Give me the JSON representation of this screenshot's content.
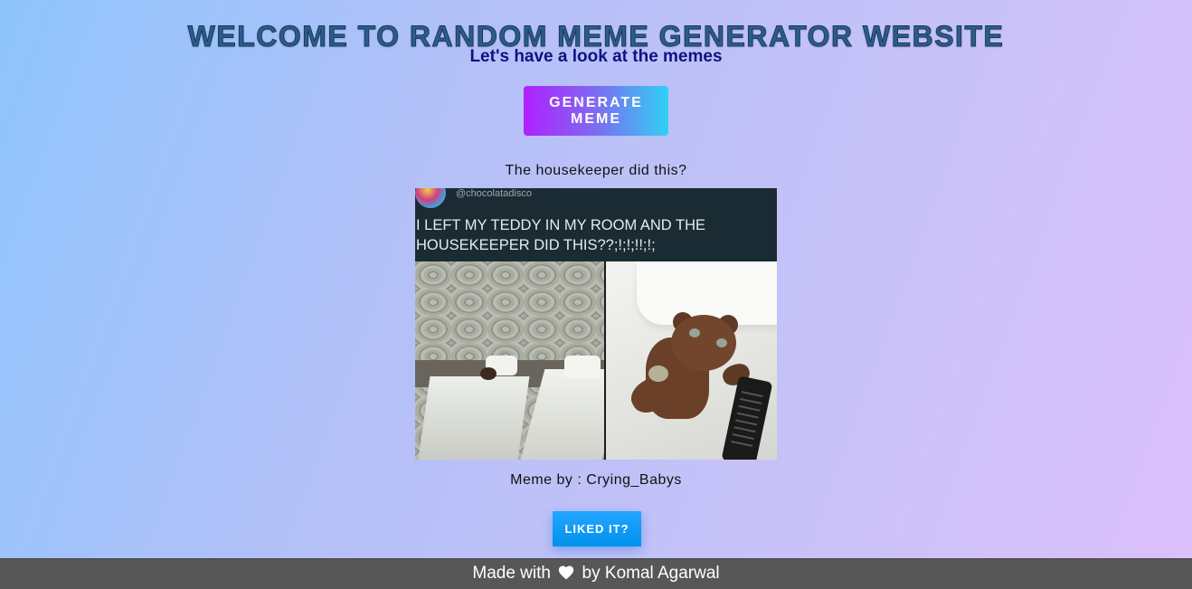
{
  "header": {
    "title": "WELCOME TO RANDOM MEME GENERATOR WEBSITE",
    "subtitle": "Let's have a look at the memes"
  },
  "actions": {
    "generate_label": "GENERATE MEME",
    "like_label": "LIKED IT?"
  },
  "meme": {
    "title": "The housekeeper did this?",
    "image": {
      "handle": "@chocolatadisco",
      "tweet_text": "I LEFT MY TEDDY IN MY ROOM AND THE HOUSEKEEPER DID THIS??;!;!;!!;!;"
    },
    "credit": "Meme by : Crying_Babys"
  },
  "footer": {
    "prefix": "Made with",
    "icon": "heart-icon",
    "suffix": "by Komal Agarwal"
  },
  "colors": {
    "title": "#2b5c8a",
    "subtitle": "#0d1480",
    "footer_bg": "#575757",
    "like_button": "#0092ec"
  }
}
